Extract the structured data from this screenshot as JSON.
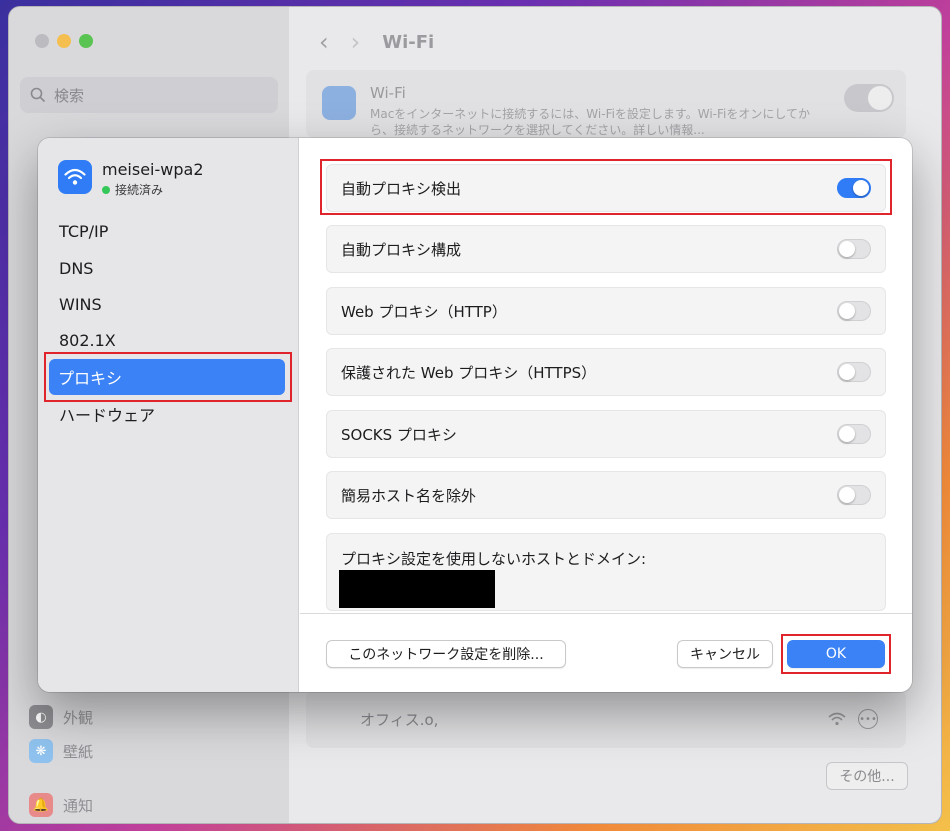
{
  "background_window": {
    "search_placeholder": "検索",
    "header_title": "Wi-Fi",
    "wifi_card": {
      "title": "Wi-Fi",
      "description": "Macをインターネットに接続するには、Wi-Fiを設定します。Wi-Fiをオンにしてから、接続するネットワークを選択してください。詳しい情報..."
    },
    "sidebar_items": [
      "外観",
      "壁紙",
      "通知"
    ],
    "network_row_name": "オフィス.o,",
    "other_button": "その他..."
  },
  "dialog": {
    "network_name": "meisei-wpa2",
    "network_status": "接続済み",
    "tabs": [
      "TCP/IP",
      "DNS",
      "WINS",
      "802.1X",
      "プロキシ",
      "ハードウェア"
    ],
    "active_tab": "プロキシ",
    "proxy_options": [
      {
        "label": "自動プロキシ検出",
        "enabled": true
      },
      {
        "label": "自動プロキシ構成",
        "enabled": false
      },
      {
        "label": "Web プロキシ（HTTP）",
        "enabled": false
      },
      {
        "label": "保護された Web プロキシ（HTTPS）",
        "enabled": false
      },
      {
        "label": "SOCKS プロキシ",
        "enabled": false
      },
      {
        "label": "簡易ホスト名を除外",
        "enabled": false
      }
    ],
    "bypass_label": "プロキシ設定を使用しないホストとドメイン:",
    "delete_button": "このネットワーク設定を削除...",
    "cancel_button": "キャンセル",
    "ok_button": "OK"
  },
  "colors": {
    "accent": "#3b82f6",
    "highlight_box": "#e0242b",
    "status_dot": "#34c759"
  }
}
